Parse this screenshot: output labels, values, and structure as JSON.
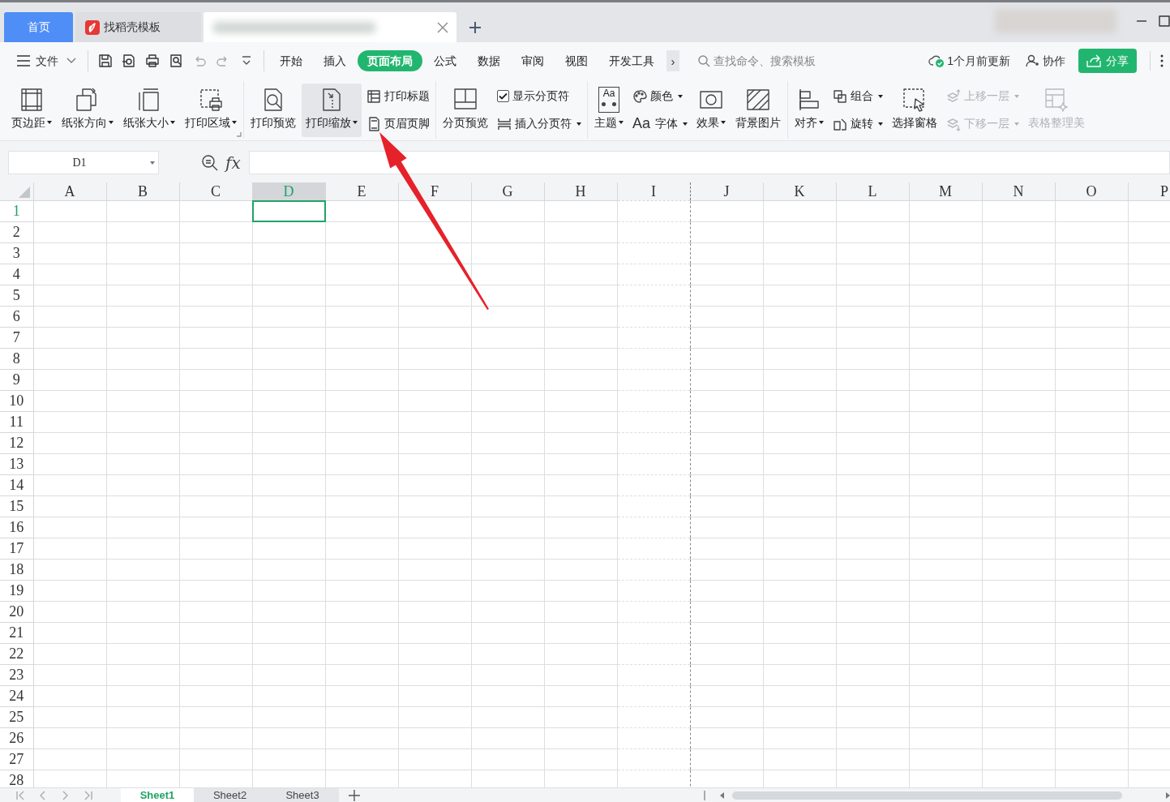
{
  "window_tabs": [
    {
      "kind": "home",
      "label": "首页",
      "selected": false
    },
    {
      "kind": "docer",
      "label": "找稻壳模板",
      "selected": false
    },
    {
      "kind": "document",
      "selected": true
    }
  ],
  "menu": {
    "file": "文件"
  },
  "ribbon_tabs": [
    {
      "label": "开始",
      "selected": false
    },
    {
      "label": "插入",
      "selected": false
    },
    {
      "label": "页面布局",
      "selected": true
    },
    {
      "label": "公式",
      "selected": false
    },
    {
      "label": "数据",
      "selected": false
    },
    {
      "label": "审阅",
      "selected": false
    },
    {
      "label": "视图",
      "selected": false
    },
    {
      "label": "开发工具",
      "selected": false
    }
  ],
  "more_tabs": "›",
  "search": {
    "placeholder": "查找命令、搜索模板"
  },
  "sync_status": "1个月前更新",
  "collaborate": "协作",
  "share": "分享",
  "ribbon": [
    {
      "items": [
        {
          "kind": "large",
          "label": "页边距",
          "dropdown": true,
          "disabled": false,
          "hovered": false
        },
        {
          "kind": "large",
          "label": "纸张方向",
          "dropdown": true,
          "disabled": false,
          "hovered": false
        },
        {
          "kind": "large",
          "label": "纸张大小",
          "dropdown": true,
          "disabled": false,
          "hovered": false
        },
        {
          "kind": "large",
          "label": "打印区域",
          "dropdown": true,
          "disabled": false,
          "hovered": false
        },
        {
          "kind": "launcher"
        }
      ]
    },
    {
      "items": [
        {
          "kind": "large",
          "label": "打印预览",
          "dropdown": false,
          "disabled": false,
          "hovered": false
        },
        {
          "kind": "large",
          "label": "打印缩放",
          "dropdown": true,
          "disabled": false,
          "hovered": true
        },
        {
          "kind": "stack",
          "items": [
            {
              "kind": "small",
              "label": "打印标题",
              "dropdown": false,
              "disabled": false
            },
            {
              "kind": "small",
              "label": "页眉页脚",
              "dropdown": false,
              "disabled": false
            }
          ]
        }
      ]
    },
    {
      "items": [
        {
          "kind": "large",
          "label": "分页预览",
          "dropdown": false,
          "disabled": false,
          "hovered": false
        },
        {
          "kind": "stack",
          "items": [
            {
              "kind": "checkbox",
              "label": "显示分页符",
              "checked": true,
              "disabled": false
            },
            {
              "kind": "small",
              "label": "插入分页符",
              "dropdown": true,
              "disabled": false
            }
          ]
        }
      ]
    },
    {
      "items": [
        {
          "kind": "large",
          "label": "主题",
          "glyph": "Aa",
          "dropdown": true,
          "disabled": false,
          "hovered": false
        },
        {
          "kind": "stack",
          "items": [
            {
              "kind": "small",
              "label": "颜色",
              "dropdown": true,
              "disabled": false
            },
            {
              "kind": "small",
              "label": "字体",
              "glyph": "Aa",
              "dropdown": true,
              "disabled": false
            }
          ]
        },
        {
          "kind": "large",
          "label": "效果",
          "dropdown": true,
          "disabled": false,
          "hovered": false
        },
        {
          "kind": "large",
          "label": "背景图片",
          "dropdown": false,
          "disabled": false,
          "hovered": false
        }
      ]
    },
    {
      "items": [
        {
          "kind": "large",
          "label": "对齐",
          "dropdown": true,
          "disabled": false,
          "hovered": false
        },
        {
          "kind": "stack",
          "items": [
            {
              "kind": "small",
              "label": "组合",
              "dropdown": true,
              "disabled": false
            },
            {
              "kind": "small",
              "label": "旋转",
              "dropdown": true,
              "disabled": false
            }
          ]
        },
        {
          "kind": "large",
          "label": "选择窗格",
          "dropdown": false,
          "disabled": false,
          "hovered": false
        },
        {
          "kind": "stack",
          "items": [
            {
              "kind": "small",
              "label": "上移一层",
              "dropdown": true,
              "disabled": true
            },
            {
              "kind": "small",
              "label": "下移一层",
              "dropdown": true,
              "disabled": true
            }
          ]
        },
        {
          "kind": "large",
          "label": "表格整理美",
          "dropdown": false,
          "disabled": true,
          "hovered": false
        }
      ]
    }
  ],
  "formula_bar": {
    "name_box": "D1",
    "fx": "fx"
  },
  "sheet": {
    "columns": [
      {
        "label": "A",
        "selected": false,
        "page_break": false
      },
      {
        "label": "B",
        "selected": false,
        "page_break": false
      },
      {
        "label": "C",
        "selected": false,
        "page_break": false
      },
      {
        "label": "D",
        "selected": true,
        "page_break": false
      },
      {
        "label": "E",
        "selected": false,
        "page_break": false
      },
      {
        "label": "F",
        "selected": false,
        "page_break": false
      },
      {
        "label": "G",
        "selected": false,
        "page_break": false
      },
      {
        "label": "H",
        "selected": false,
        "page_break": false
      },
      {
        "label": "I",
        "selected": false,
        "page_break": true
      },
      {
        "label": "J",
        "selected": false,
        "page_break": false
      },
      {
        "label": "K",
        "selected": false,
        "page_break": false
      },
      {
        "label": "L",
        "selected": false,
        "page_break": false
      },
      {
        "label": "M",
        "selected": false,
        "page_break": false
      },
      {
        "label": "N",
        "selected": false,
        "page_break": false
      },
      {
        "label": "O",
        "selected": false,
        "page_break": false
      },
      {
        "label": "P",
        "selected": false,
        "page_break": false
      }
    ],
    "rows": [
      {
        "label": "1",
        "selected": true
      },
      {
        "label": "2",
        "selected": false
      },
      {
        "label": "3",
        "selected": false
      },
      {
        "label": "4",
        "selected": false
      },
      {
        "label": "5",
        "selected": false
      },
      {
        "label": "6",
        "selected": false
      },
      {
        "label": "7",
        "selected": false
      },
      {
        "label": "8",
        "selected": false
      },
      {
        "label": "9",
        "selected": false
      },
      {
        "label": "10",
        "selected": false
      },
      {
        "label": "11",
        "selected": false
      },
      {
        "label": "12",
        "selected": false
      },
      {
        "label": "13",
        "selected": false
      },
      {
        "label": "14",
        "selected": false
      },
      {
        "label": "15",
        "selected": false
      },
      {
        "label": "16",
        "selected": false
      },
      {
        "label": "17",
        "selected": false
      },
      {
        "label": "18",
        "selected": false
      },
      {
        "label": "19",
        "selected": false
      },
      {
        "label": "20",
        "selected": false
      },
      {
        "label": "21",
        "selected": false
      },
      {
        "label": "22",
        "selected": false
      },
      {
        "label": "23",
        "selected": false
      },
      {
        "label": "24",
        "selected": false
      },
      {
        "label": "25",
        "selected": false
      },
      {
        "label": "26",
        "selected": false
      },
      {
        "label": "27",
        "selected": false
      },
      {
        "label": "28",
        "selected": false
      }
    ]
  },
  "sheet_tabs": [
    {
      "label": "Sheet1",
      "selected": true
    },
    {
      "label": "Sheet2",
      "selected": false
    },
    {
      "label": "Sheet3",
      "selected": false
    }
  ]
}
